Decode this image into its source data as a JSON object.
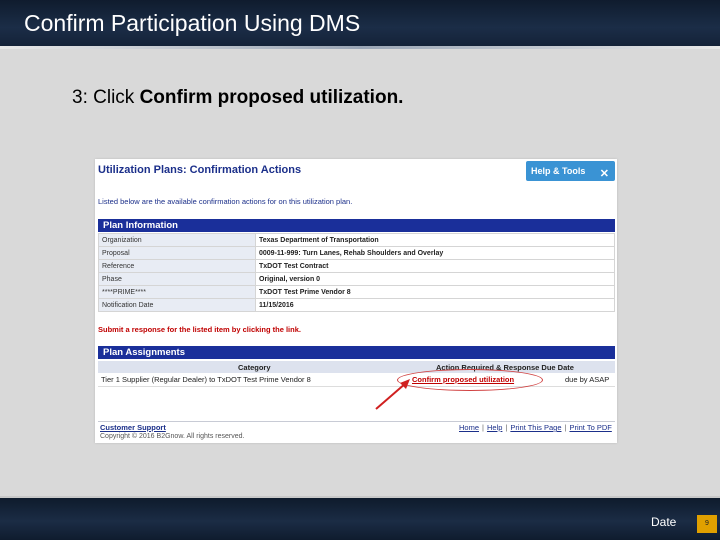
{
  "slide": {
    "title": "Confirm Participation Using DMS",
    "instruction_prefix": "3: Click ",
    "instruction_bold": "Confirm proposed utilization.",
    "date_label": "Date",
    "page_number": "9"
  },
  "screenshot": {
    "heading": "Utilization Plans: Confirmation Actions",
    "help_button": "Help & Tools",
    "listed_text": "Listed below are the available confirmation actions for on this utilization plan.",
    "plan_info_title": "Plan Information",
    "plan_info": [
      {
        "key": "Organization",
        "value": "Texas Department of Transportation"
      },
      {
        "key": "Proposal",
        "value": "0009-11-999: Turn Lanes, Rehab Shoulders and Overlay"
      },
      {
        "key": "Reference",
        "value": "TxDOT Test Contract"
      },
      {
        "key": "Phase",
        "value": "Original, version 0"
      },
      {
        "key": "****PRIME****",
        "value": "TxDOT Test Prime Vendor 8"
      },
      {
        "key": "Notification Date",
        "value": "11/15/2016"
      }
    ],
    "submit_text": "Submit a response for the listed item by clicking the link.",
    "assignments_title": "Plan Assignments",
    "col_category": "Category",
    "col_action": "Action Required & Response Due Date",
    "row_category": "Tier 1 Supplier (Regular Dealer) to TxDOT Test Prime Vendor 8",
    "row_link": "Confirm proposed utilization",
    "row_due": "due by ASAP",
    "customer_support": "Customer Support",
    "copyright": "Copyright © 2016 B2Gnow. All rights reserved.",
    "footer_links": [
      "Home",
      "Help",
      "Print This Page",
      "Print To PDF"
    ]
  },
  "colors": {
    "accent_blue": "#1a2f9a",
    "link_red": "#c00000",
    "help_blue": "#3a93d4",
    "page_badge": "#e0a000"
  },
  "icons": {
    "help": "tools-icon",
    "pointer": "red-arrow-icon"
  }
}
